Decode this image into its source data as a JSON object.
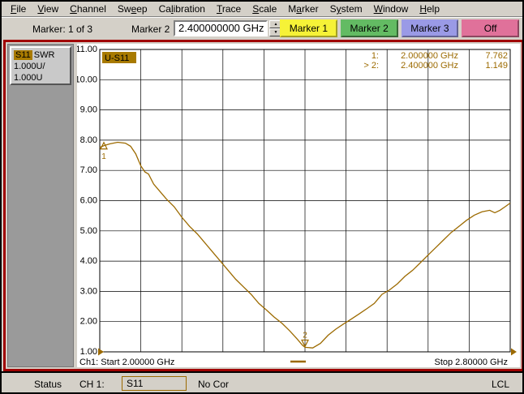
{
  "menu": {
    "items": [
      {
        "label": "File",
        "underline": 0
      },
      {
        "label": "View",
        "underline": 0
      },
      {
        "label": "Channel",
        "underline": 0
      },
      {
        "label": "Sweep",
        "underline": 2
      },
      {
        "label": "Calibration",
        "underline": 2
      },
      {
        "label": "Trace",
        "underline": 0
      },
      {
        "label": "Scale",
        "underline": 0
      },
      {
        "label": "Marker",
        "underline": 1
      },
      {
        "label": "System",
        "underline": 1
      },
      {
        "label": "Window",
        "underline": 0
      },
      {
        "label": "Help",
        "underline": 0
      }
    ]
  },
  "toolbar": {
    "marker_count": "Marker: 1 of 3",
    "field_label": "Marker 2",
    "field_value": "2.400000000 GHz",
    "buttons": [
      {
        "label": "Marker 1",
        "color": "#f6f237"
      },
      {
        "label": "Marker 2",
        "color": "#63bb63"
      },
      {
        "label": "Marker 3",
        "color": "#9a9ae6"
      },
      {
        "label": "Off",
        "color": "#e0719a"
      }
    ]
  },
  "sidebar": {
    "measurement": "S11",
    "format": "SWR",
    "scale": "1.000U/",
    "reference": "1.000U"
  },
  "chart": {
    "trace_label": "U-S11",
    "readout": [
      {
        "label": "1:",
        "freq": "2.000000 GHz",
        "value": "7.762"
      },
      {
        "label": "> 2:",
        "freq": "2.400000 GHz",
        "value": "1.149"
      }
    ],
    "start_label": "Ch1: Start  2.00000 GHz",
    "stop_label": "Stop  2.80000 GHz",
    "trace_color": "#9c6a00",
    "grid_color": "#000000"
  },
  "chart_data": {
    "type": "line",
    "title": "U-S11",
    "x_unit": "GHz",
    "xlim": [
      2.0,
      2.8
    ],
    "ylim": [
      1.0,
      11.0
    ],
    "ytick_step": 1.0,
    "yticks": [
      "11.00",
      "10.00",
      "9.00",
      "8.00",
      "7.00",
      "6.00",
      "5.00",
      "4.00",
      "3.00",
      "2.00",
      "1.00"
    ],
    "grid": "on",
    "grid_divisions": [
      10,
      10
    ],
    "series": [
      {
        "name": "U-S11 SWR",
        "color": "#9c6a00",
        "points": [
          [
            2.0,
            7.76
          ],
          [
            2.01,
            7.83
          ],
          [
            2.02,
            7.88
          ],
          [
            2.035,
            7.93
          ],
          [
            2.05,
            7.9
          ],
          [
            2.06,
            7.8
          ],
          [
            2.07,
            7.55
          ],
          [
            2.08,
            7.15
          ],
          [
            2.088,
            6.95
          ],
          [
            2.095,
            6.88
          ],
          [
            2.105,
            6.55
          ],
          [
            2.115,
            6.35
          ],
          [
            2.13,
            6.05
          ],
          [
            2.145,
            5.8
          ],
          [
            2.16,
            5.45
          ],
          [
            2.175,
            5.15
          ],
          [
            2.19,
            4.9
          ],
          [
            2.205,
            4.6
          ],
          [
            2.22,
            4.3
          ],
          [
            2.235,
            4.0
          ],
          [
            2.25,
            3.7
          ],
          [
            2.265,
            3.4
          ],
          [
            2.28,
            3.15
          ],
          [
            2.295,
            2.9
          ],
          [
            2.31,
            2.6
          ],
          [
            2.325,
            2.38
          ],
          [
            2.34,
            2.15
          ],
          [
            2.355,
            1.95
          ],
          [
            2.37,
            1.7
          ],
          [
            2.385,
            1.42
          ],
          [
            2.395,
            1.22
          ],
          [
            2.4,
            1.15
          ],
          [
            2.415,
            1.13
          ],
          [
            2.43,
            1.28
          ],
          [
            2.445,
            1.55
          ],
          [
            2.46,
            1.75
          ],
          [
            2.475,
            1.92
          ],
          [
            2.49,
            2.08
          ],
          [
            2.505,
            2.25
          ],
          [
            2.52,
            2.42
          ],
          [
            2.535,
            2.6
          ],
          [
            2.55,
            2.9
          ],
          [
            2.565,
            3.05
          ],
          [
            2.58,
            3.25
          ],
          [
            2.595,
            3.5
          ],
          [
            2.61,
            3.7
          ],
          [
            2.625,
            3.95
          ],
          [
            2.64,
            4.2
          ],
          [
            2.655,
            4.45
          ],
          [
            2.67,
            4.7
          ],
          [
            2.685,
            4.95
          ],
          [
            2.7,
            5.15
          ],
          [
            2.715,
            5.35
          ],
          [
            2.73,
            5.52
          ],
          [
            2.745,
            5.63
          ],
          [
            2.76,
            5.68
          ],
          [
            2.77,
            5.6
          ],
          [
            2.78,
            5.68
          ],
          [
            2.79,
            5.8
          ],
          [
            2.8,
            5.92
          ]
        ]
      }
    ],
    "markers": [
      {
        "n": "1",
        "ghz": 2.0,
        "value": 7.762,
        "active": false
      },
      {
        "n": "2",
        "ghz": 2.4,
        "value": 1.149,
        "active": true
      }
    ]
  },
  "status_bar": {
    "status_label": "Status",
    "channel_label": "CH 1:",
    "measurement": "S11",
    "correction": "No Cor",
    "mode": "LCL"
  }
}
